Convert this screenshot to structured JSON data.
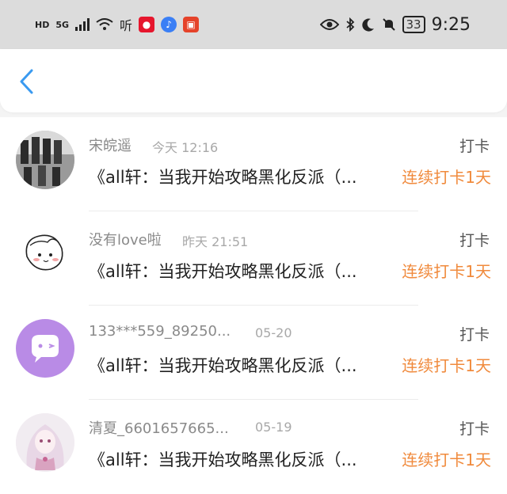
{
  "status_bar": {
    "hd": "HD",
    "net": "5G",
    "app_ting": "听",
    "time": "9:25",
    "battery": "33",
    "colors": {
      "weibo": "#e6162d",
      "music": "#3b7ff5",
      "ting": "#e5432a"
    }
  },
  "navbar": {
    "back_icon": "chevron-left-icon"
  },
  "colors": {
    "accent": "#f08a3c",
    "back": "#3a9af0",
    "avatar_bg": "#b98be6"
  },
  "rows": [
    {
      "name": "宋皖遥",
      "time": "今天 12:16",
      "kind": "打卡",
      "book": "《all轩：当我开始攻略黑化反派（...",
      "streak": "连续打卡1天"
    },
    {
      "name": "没有love啦",
      "time": "昨天 21:51",
      "kind": "打卡",
      "book": "《all轩：当我开始攻略黑化反派（...",
      "streak": "连续打卡1天"
    },
    {
      "name": "133***559_89250...",
      "time": "05-20",
      "kind": "打卡",
      "book": "《all轩：当我开始攻略黑化反派（...",
      "streak": "连续打卡1天"
    },
    {
      "name": "清夏_6601657665...",
      "time": "05-19",
      "kind": "打卡",
      "book": "《all轩：当我开始攻略黑化反派（...",
      "streak": "连续打卡1天"
    }
  ]
}
